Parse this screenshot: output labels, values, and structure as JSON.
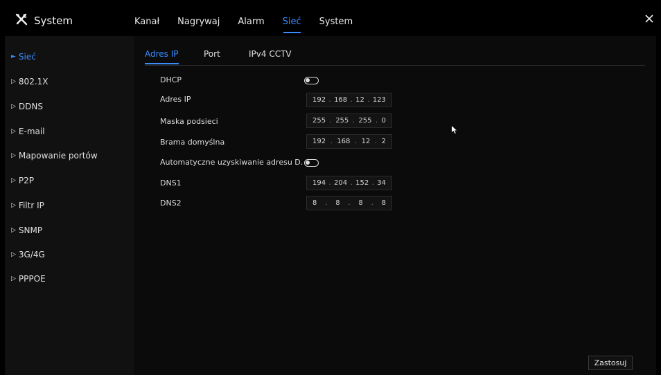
{
  "app": {
    "title": "System",
    "logo_icon": "tools-icon",
    "accent": "#3a8cff"
  },
  "topnav": [
    {
      "label": "Kanał"
    },
    {
      "label": "Nagrywaj"
    },
    {
      "label": "Alarm"
    },
    {
      "label": "Sieć",
      "active": true
    },
    {
      "label": "System"
    }
  ],
  "sidebar": {
    "items": [
      {
        "label": "Sieć",
        "active": true
      },
      {
        "label": "802.1X"
      },
      {
        "label": "DDNS"
      },
      {
        "label": "E-mail"
      },
      {
        "label": "Mapowanie portów"
      },
      {
        "label": "P2P"
      },
      {
        "label": "Filtr IP"
      },
      {
        "label": "SNMP"
      },
      {
        "label": "3G/4G"
      },
      {
        "label": "PPPOE"
      }
    ]
  },
  "subtabs": [
    {
      "label": "Adres IP",
      "active": true
    },
    {
      "label": "Port"
    },
    {
      "label": "IPv4 CCTV"
    }
  ],
  "form": {
    "dhcp": {
      "label": "DHCP",
      "enabled": false
    },
    "ip": {
      "label": "Adres IP",
      "octets": [
        "192",
        "168",
        "12",
        "123"
      ]
    },
    "mask": {
      "label": "Maska podsieci",
      "octets": [
        "255",
        "255",
        "255",
        "0"
      ]
    },
    "gateway": {
      "label": "Brama domyślna",
      "octets": [
        "192",
        "168",
        "12",
        "2"
      ]
    },
    "auto_dns": {
      "label": "Automatyczne uzyskiwanie adresu D.",
      "enabled": false
    },
    "dns1": {
      "label": "DNS1",
      "octets": [
        "194",
        "204",
        "152",
        "34"
      ]
    },
    "dns2": {
      "label": "DNS2",
      "octets": [
        "8",
        "8",
        "8",
        "8"
      ]
    }
  },
  "apply_label": "Zastosuj"
}
